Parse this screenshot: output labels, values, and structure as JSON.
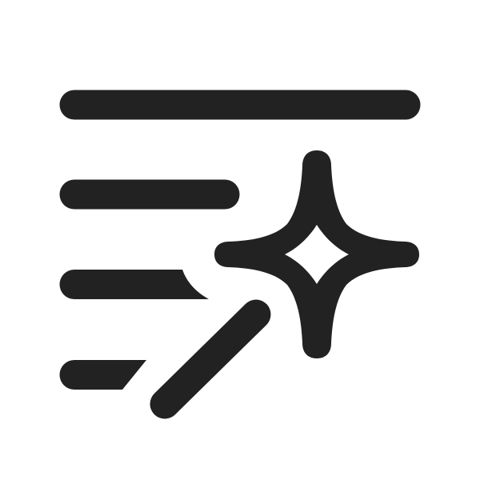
{
  "icon": {
    "name": "text-sparkle-icon",
    "color": "#222222",
    "background": "#ffffff"
  }
}
